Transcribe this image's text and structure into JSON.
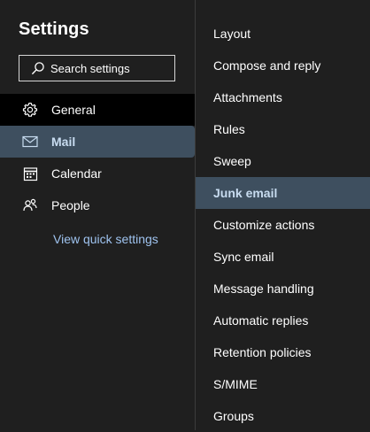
{
  "header": {
    "title": "Settings"
  },
  "search": {
    "placeholder": "Search settings"
  },
  "nav": {
    "items": [
      {
        "label": "General",
        "icon": "gear-icon"
      },
      {
        "label": "Mail",
        "icon": "mail-icon",
        "selected": true
      },
      {
        "label": "Calendar",
        "icon": "calendar-icon"
      },
      {
        "label": "People",
        "icon": "people-icon"
      }
    ],
    "quick_settings_link": "View quick settings"
  },
  "mail_submenu": {
    "items": [
      {
        "label": "Layout"
      },
      {
        "label": "Compose and reply"
      },
      {
        "label": "Attachments"
      },
      {
        "label": "Rules"
      },
      {
        "label": "Sweep"
      },
      {
        "label": "Junk email",
        "selected": true
      },
      {
        "label": "Customize actions"
      },
      {
        "label": "Sync email"
      },
      {
        "label": "Message handling"
      },
      {
        "label": "Automatic replies"
      },
      {
        "label": "Retention policies"
      },
      {
        "label": "S/MIME"
      },
      {
        "label": "Groups"
      }
    ]
  },
  "colors": {
    "background": "#1f1f1f",
    "selected_background": "#3e4f5f",
    "selected_text": "#c8dcf0",
    "link": "#9fc3ef",
    "divider": "#3b3b3b"
  }
}
